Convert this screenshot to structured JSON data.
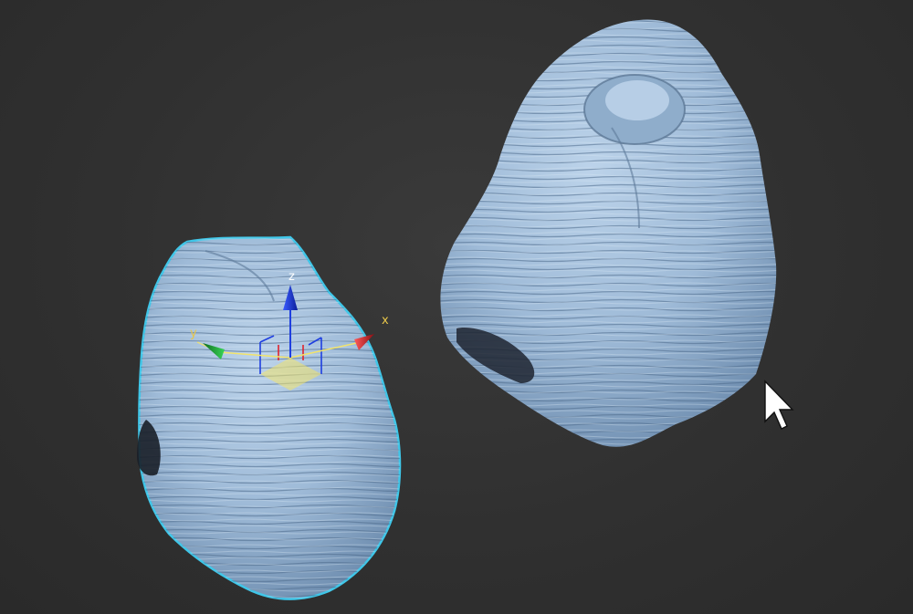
{
  "viewport": {
    "background_color": "#303030",
    "objects": [
      {
        "name": "rock-left",
        "color": "#a9c3de",
        "selected": true,
        "selection_outline_color": "#3fc6e8"
      },
      {
        "name": "rock-right",
        "color": "#a9c3de",
        "selected": false
      }
    ],
    "gizmo": {
      "type": "move-gizmo",
      "axes": {
        "x": {
          "label": "x",
          "color": "#e0232c",
          "label_color": "#e8c64a"
        },
        "y": {
          "label": "y",
          "color": "#22b43b",
          "label_color": "#e8c64a"
        },
        "z": {
          "label": "z",
          "color": "#1f3fe0",
          "label_color": "#ffffff"
        }
      },
      "plane_highlight_color": "#f2e36a"
    },
    "cursor": {
      "icon": "arrow-cursor-icon"
    }
  }
}
